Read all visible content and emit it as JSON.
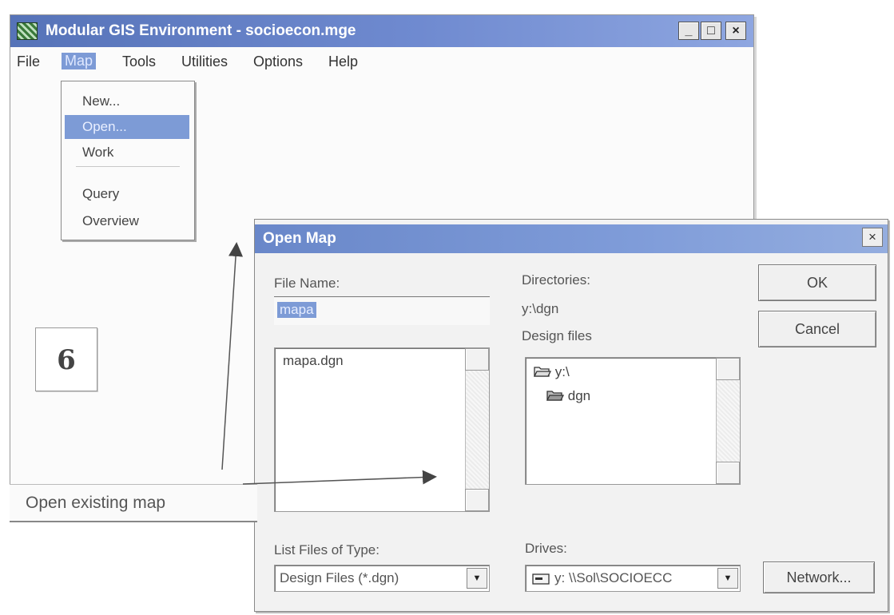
{
  "main_window": {
    "title": "Modular GIS Environment - socioecon.mge",
    "buttons": {
      "minimize": "_",
      "maximize": "□",
      "close": "×"
    }
  },
  "menubar": {
    "items": [
      "File",
      "Map",
      "Tools",
      "Utilities",
      "Options",
      "Help"
    ],
    "active": "Map"
  },
  "map_menu": {
    "items": [
      "New...",
      "Open...",
      "Work",
      "Query",
      "Overview"
    ],
    "selected": "Open..."
  },
  "step_number": "6",
  "caption": "Open existing map",
  "dialog": {
    "title": "Open Map",
    "close": "×",
    "file_name_label": "File Name:",
    "file_name_value": "mapa",
    "files": [
      "mapa.dgn"
    ],
    "directories_label": "Directories:",
    "current_directory": "y:\\dgn",
    "directory_subtitle": "Design files",
    "directory_tree": [
      "y:\\",
      "dgn"
    ],
    "ok_label": "OK",
    "cancel_label": "Cancel",
    "list_type_label": "List Files of Type:",
    "list_type_value": "Design Files (*.dgn)",
    "drives_label": "Drives:",
    "drives_value": "y: \\\\Sol\\SOCIOECC",
    "network_label": "Network...",
    "accent": "#7d9bd6"
  }
}
